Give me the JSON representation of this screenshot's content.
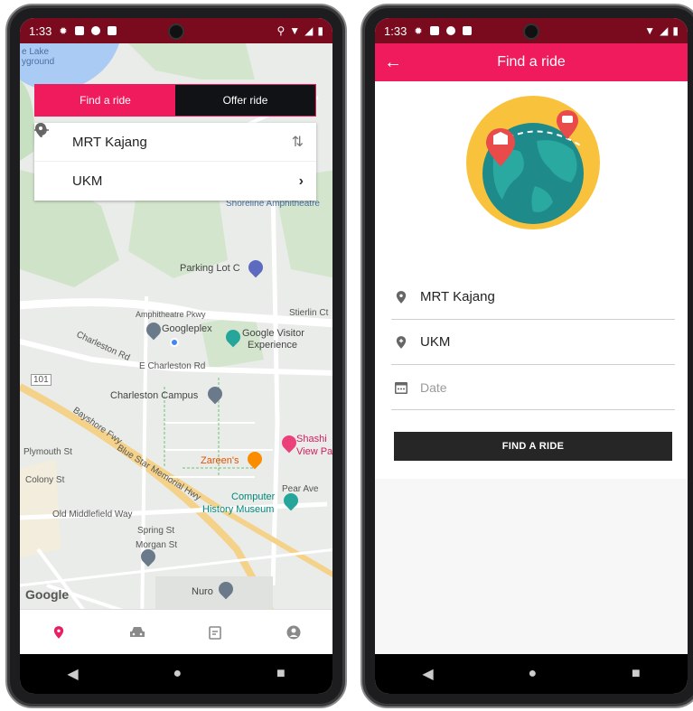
{
  "left_screen": {
    "status": {
      "time": "1:33"
    },
    "tabs": [
      {
        "label": "Find a ride",
        "active": true
      },
      {
        "label": "Offer ride",
        "active": false
      }
    ],
    "route": {
      "origin": "MRT Kajang",
      "destination": "UKM"
    },
    "map_labels": {
      "lake_playground": "e Lake\nyground",
      "parking": "Parking Lot C",
      "amphitheatre_pkwy": "Amphitheatre Pkwy",
      "googleplex": "Googleplex",
      "google_visitor": "Google Visitor",
      "experience": "Experience",
      "charleston_rd": "Charleston Rd",
      "e_charleston_rd": "E Charleston Rd",
      "charleston_campus": "Charleston Campus",
      "shashi": "Shashi",
      "view_pa": "View Pa",
      "zareens": "Zareen's",
      "plymouth": "Plymouth St",
      "colony": "Colony St",
      "old_middlefield": "Old Middlefield Way",
      "spring": "Spring St",
      "morgan": "Morgan St",
      "computer": "Computer",
      "history_museum": "History Museum",
      "nuro": "Nuro",
      "bayshore": "Bayshore Fwy",
      "blue_star": "Blue Star Memorial Hwy",
      "stierlin": "Stierlin Ct",
      "shoreline_amph": "Shoreline Amphitheatre",
      "pear": "Pear Ave",
      "route_101": "101",
      "google_logo": "Google"
    },
    "bottom_nav": [
      "location-icon",
      "car-icon",
      "calendar-icon",
      "profile-icon"
    ]
  },
  "right_screen": {
    "status": {
      "time": "1:33"
    },
    "appbar_title": "Find a ride",
    "fields": [
      {
        "value": "MRT Kajang",
        "icon": "location-pin-icon"
      },
      {
        "value": "UKM",
        "icon": "location-plus-icon"
      },
      {
        "placeholder": "Date",
        "icon": "calendar-icon"
      }
    ],
    "button_label": "FIND A RIDE"
  },
  "colors": {
    "accent": "#ef1b5c",
    "status_bar": "#7a0a1d",
    "dark": "#111216"
  }
}
